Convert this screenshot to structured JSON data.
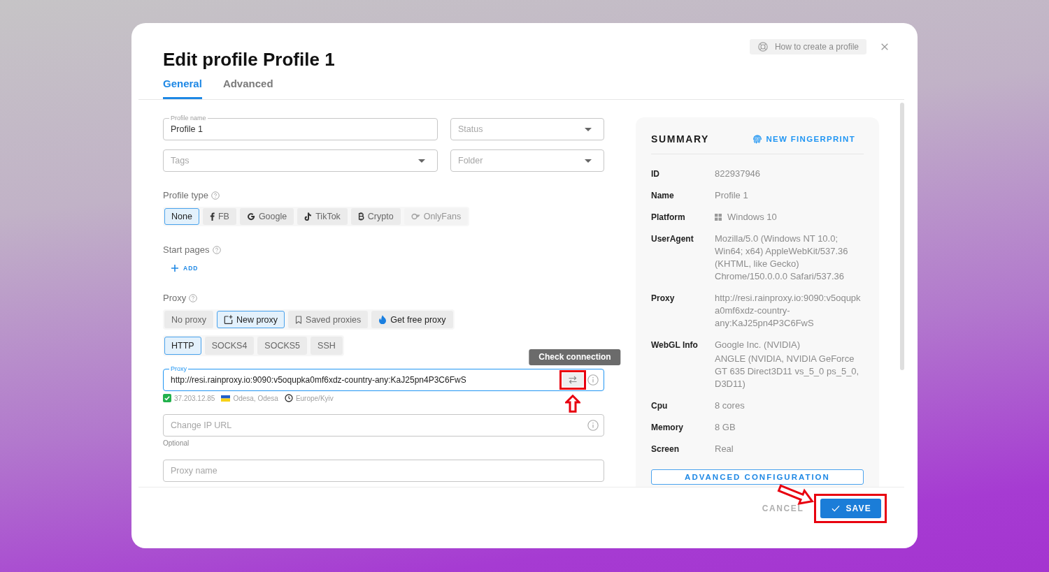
{
  "window": {
    "title": "Edit profile Profile 1"
  },
  "header": {
    "help_button": "How to create a profile"
  },
  "tabs": [
    {
      "label": "General",
      "selected": true
    },
    {
      "label": "Advanced",
      "selected": false
    }
  ],
  "form": {
    "profile_name": {
      "label": "Profile name",
      "value": "Profile 1"
    },
    "status": {
      "placeholder": "Status"
    },
    "tags": {
      "placeholder": "Tags"
    },
    "folder": {
      "placeholder": "Folder"
    },
    "profile_type": {
      "label": "Profile type",
      "options": [
        {
          "label": "None",
          "selected": true,
          "disabled": false
        },
        {
          "label": "FB",
          "selected": false,
          "disabled": false
        },
        {
          "label": "Google",
          "selected": false,
          "disabled": false
        },
        {
          "label": "TikTok",
          "selected": false,
          "disabled": false
        },
        {
          "label": "Crypto",
          "selected": false,
          "disabled": false
        },
        {
          "label": "OnlyFans",
          "selected": false,
          "disabled": true
        }
      ]
    },
    "start_pages": {
      "label": "Start pages",
      "add_button": "ADD"
    },
    "proxy": {
      "label": "Proxy",
      "modes": [
        {
          "label": "No proxy",
          "selected": false,
          "emphasized": false
        },
        {
          "label": "New proxy",
          "selected": true,
          "emphasized": false
        },
        {
          "label": "Saved proxies",
          "selected": false,
          "emphasized": false
        },
        {
          "label": "Get free proxy",
          "selected": false,
          "emphasized": true
        }
      ],
      "protocols": [
        {
          "label": "HTTP",
          "selected": true
        },
        {
          "label": "SOCKS4",
          "selected": false
        },
        {
          "label": "SOCKS5",
          "selected": false
        },
        {
          "label": "SSH",
          "selected": false
        }
      ],
      "field": {
        "label": "Proxy",
        "value": "http://resi.rainproxy.io:9090:v5oqupka0mf6xdz-country-any:KaJ25pn4P3C6FwS",
        "focused": true,
        "tooltip": "Check connection"
      },
      "check_result": [
        {
          "kind": "ip",
          "text": "37.203.12.85"
        },
        {
          "kind": "location",
          "text": "Odesa, Odesa"
        },
        {
          "kind": "timezone",
          "text": "Europe/Kyiv"
        }
      ],
      "change_ip_url": {
        "placeholder": "Change IP URL",
        "helper": "Optional"
      },
      "proxy_name": {
        "placeholder": "Proxy name"
      }
    }
  },
  "summary": {
    "title": "SUMMARY",
    "action": "NEW FINGERPRINT",
    "rows": [
      {
        "kind": "text",
        "label": "ID",
        "values": [
          "822937946"
        ]
      },
      {
        "kind": "text",
        "label": "Name",
        "values": [
          "Profile 1"
        ]
      },
      {
        "kind": "os",
        "label": "Platform",
        "values": [
          "Windows 10"
        ]
      },
      {
        "kind": "text",
        "label": "UserAgent",
        "values": [
          "Mozilla/5.0 (Windows NT 10.0; Win64; x64) AppleWebKit/537.36 (KHTML, like Gecko) Chrome/150.0.0.0 Safari/537.36"
        ]
      },
      {
        "kind": "text",
        "label": "Proxy",
        "values": [
          "http://resi.rainproxy.io:9090:v5oqupka0mf6xdz-country-any:KaJ25pn4P3C6FwS"
        ]
      },
      {
        "kind": "text",
        "label": "WebGL Info",
        "values": [
          "Google Inc. (NVIDIA)",
          "ANGLE (NVIDIA, NVIDIA GeForce GT 635 Direct3D11 vs_5_0 ps_5_0, D3D11)"
        ]
      },
      {
        "kind": "text",
        "label": "Cpu",
        "values": [
          "8 cores"
        ]
      },
      {
        "kind": "text",
        "label": "Memory",
        "values": [
          "8 GB"
        ]
      },
      {
        "kind": "text",
        "label": "Screen",
        "values": [
          "Real"
        ]
      }
    ],
    "button": "ADVANCED CONFIGURATION"
  },
  "footer": {
    "cancel": "CANCEL",
    "save": "SAVE"
  }
}
